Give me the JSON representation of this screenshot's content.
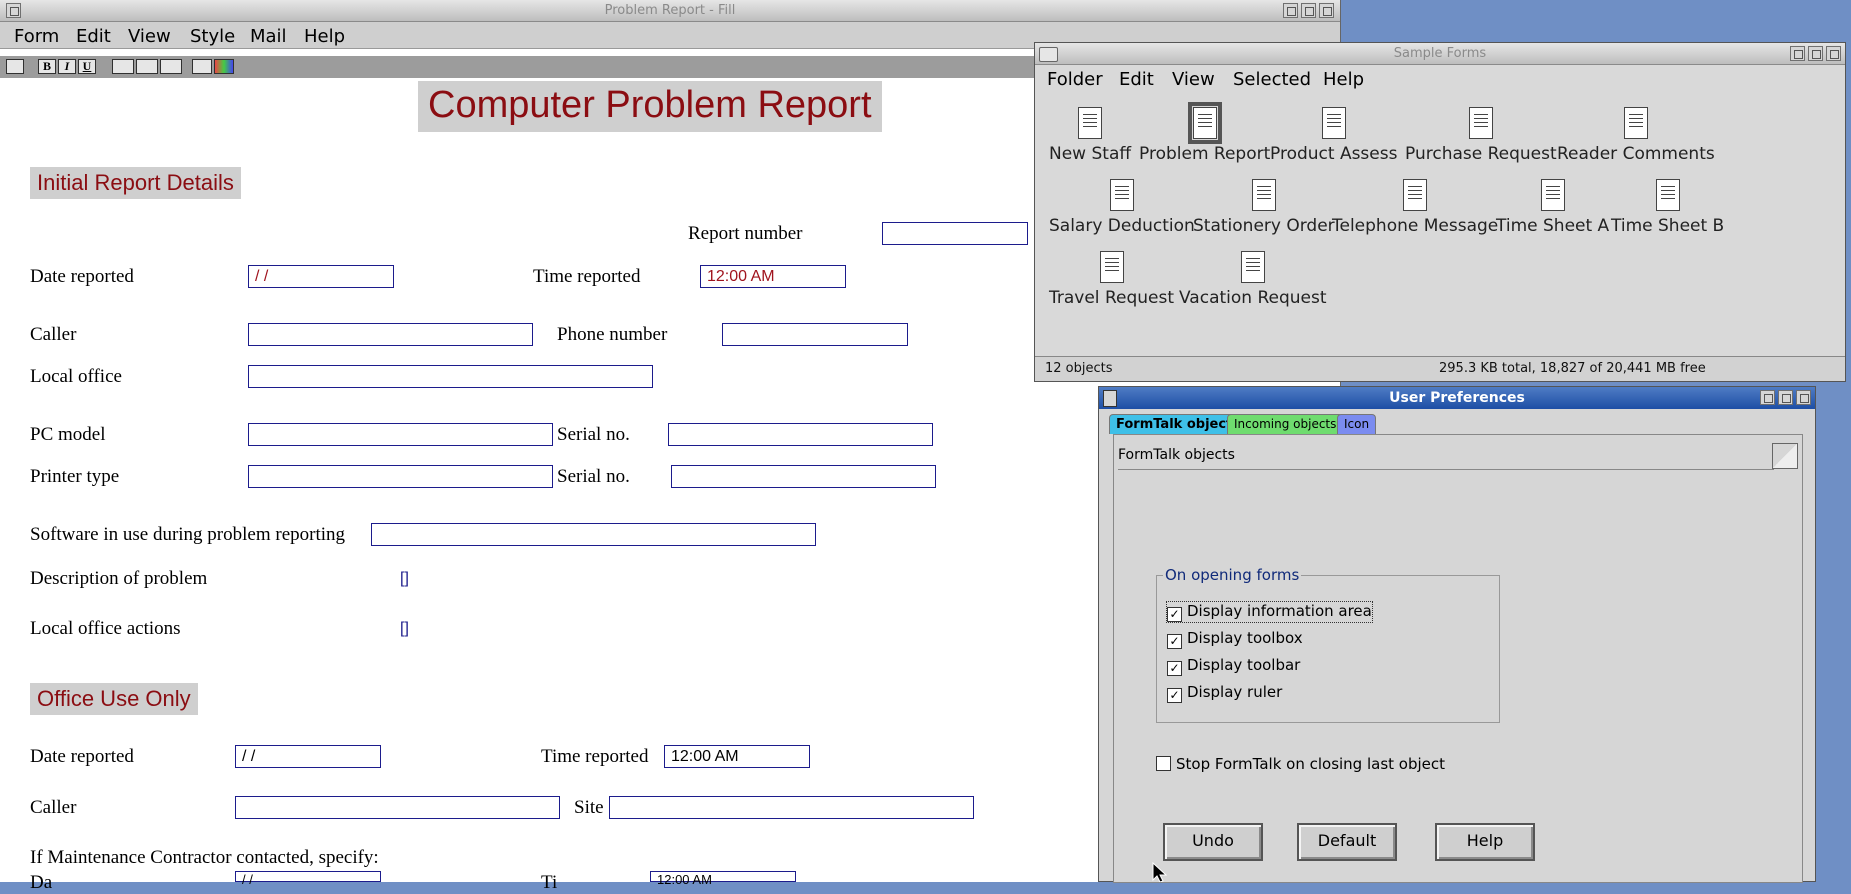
{
  "form_window": {
    "title": "Problem Report - Fill",
    "menu": [
      "Form",
      "Edit",
      "View",
      "Style",
      "Mail",
      "Help"
    ],
    "toolbar": {
      "bold": "B",
      "italic": "I",
      "underline": "U"
    },
    "heading": "Computer Problem Report",
    "section1": "Initial Report Details",
    "report_number_label": "Report number",
    "date_reported_label": "Date reported",
    "date_value": " /  /",
    "time_reported_label": "Time reported",
    "time_value": "12:00 AM",
    "caller_label": "Caller",
    "phone_label": "Phone number",
    "local_office_label": "Local  office",
    "pc_model_label": "PC model",
    "serial_label": "Serial no.",
    "printer_type_label": "Printer type",
    "software_label": "Software in use during problem reporting",
    "description_label": "Description of problem",
    "local_actions_label": "Local office actions",
    "memo_marker": "[]",
    "section2": "Office Use Only",
    "site_label": "Site",
    "maintenance_label": "If Maintenance Contractor contacted, specify:",
    "date_short_label": "Da",
    "time_short_label": "Ti",
    "date_value2": " /  /",
    "time_value2": "12:00 AM"
  },
  "samples_window": {
    "title": "Sample Forms",
    "menu": [
      "Folder",
      "Edit",
      "View",
      "Selected",
      "Help"
    ],
    "items": [
      "New Staff",
      "Problem Report",
      "Product Assess",
      "Purchase Request",
      "Reader Comments",
      "Salary Deduction",
      "Stationery Order",
      "Telephone Message",
      "Time Sheet A",
      "Time Sheet B",
      "Travel Request",
      "Vacation Request"
    ],
    "selected": "Problem Report",
    "status_left": "12 objects",
    "status_right": "295.3 KB total, 18,827 of 20,441 MB free"
  },
  "prefs_window": {
    "title": "User Preferences",
    "tabs": [
      {
        "label": "FormTalk objects",
        "color": "#3fc0e8"
      },
      {
        "label": "Incoming objects",
        "color": "#6fdc6f"
      },
      {
        "label": "Icon",
        "color": "#7b8cf0"
      }
    ],
    "panel_title": "FormTalk objects",
    "group_title": "On opening forms",
    "options": [
      {
        "label": "Display information area",
        "checked": true
      },
      {
        "label": "Display toolbox",
        "checked": true
      },
      {
        "label": "Display toolbar",
        "checked": true
      },
      {
        "label": "Display ruler",
        "checked": true
      }
    ],
    "stop_option": {
      "label": "Stop FormTalk on closing last object",
      "checked": false
    },
    "buttons": {
      "undo": "Undo",
      "default": "Default",
      "help": "Help"
    }
  },
  "colors": {
    "desktop": "#6f8fc5",
    "heading_text": "#8b0d12",
    "field_border": "#1c1c8c",
    "prefs_titlebar": "#1d4ea5"
  }
}
